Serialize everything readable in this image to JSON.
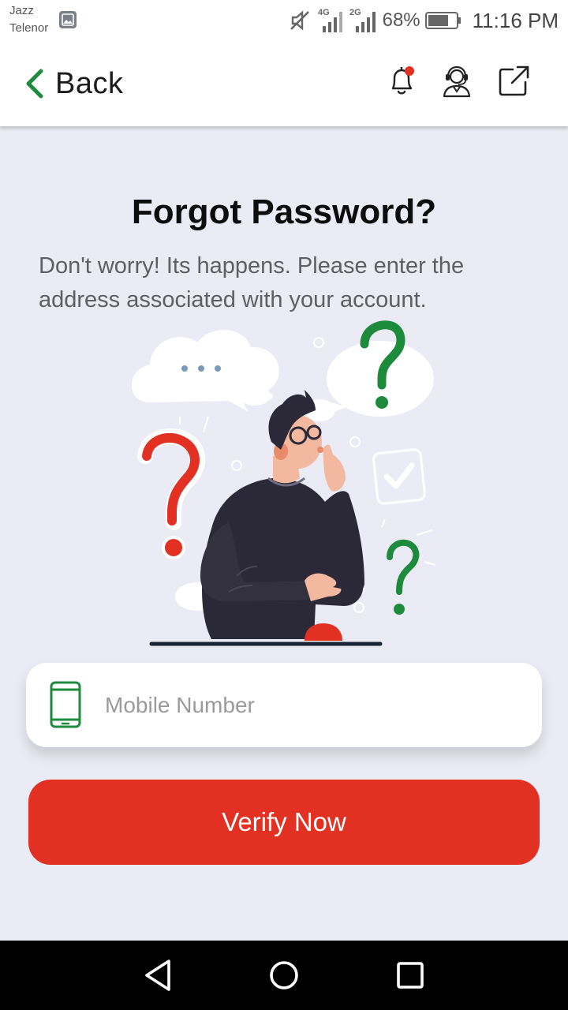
{
  "status_bar": {
    "carrier_1": "Jazz",
    "carrier_2": "Telenor",
    "net_1": "4G",
    "net_2": "2G",
    "battery": "68%",
    "time": "11:16 PM"
  },
  "app_bar": {
    "back_label": "Back",
    "accent": "#1e8a3c",
    "icons": [
      "bell-icon",
      "support-agent-icon",
      "external-link-icon"
    ],
    "notification_dot_color": "#e23022"
  },
  "content": {
    "title": "Forgot Password?",
    "subtitle": "Don't worry! Its happens. Please enter the address associated with your account.",
    "mobile_placeholder": "Mobile Number",
    "mobile_value": "",
    "verify_label": "Verify Now",
    "button_color": "#e23022"
  },
  "nav": {
    "buttons": [
      "back-triangle-icon",
      "home-circle-icon",
      "recents-square-icon"
    ]
  }
}
